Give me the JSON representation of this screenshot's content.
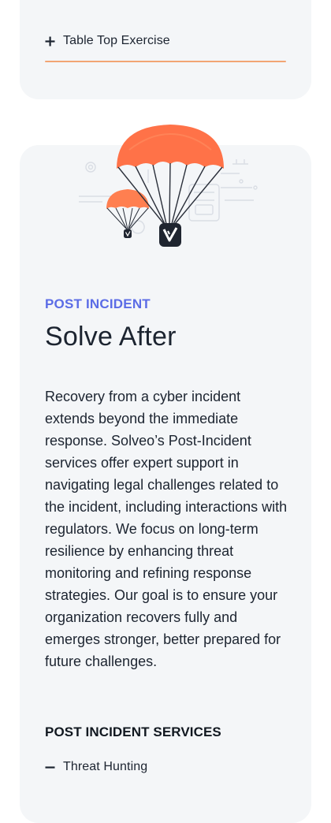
{
  "top_accordion": {
    "label": "Table Top Exercise",
    "icon": "plus-icon"
  },
  "illustration": {
    "icon": "parachute-illustration",
    "accent_color": "#ff7f50"
  },
  "section": {
    "eyebrow": "POST INCIDENT",
    "title": "Solve After",
    "body": "Recovery from a cyber incident extends beyond the immediate response. Solveo’s Post-Incident services offer expert support in navigating legal challenges related to the incident, including interactions with regulators. We focus on long-term resilience by enhancing threat monitoring and refining response strategies. Our goal is to ensure your organization recovers fully and emerges stronger, better prepared for future challenges."
  },
  "services": {
    "heading": "POST INCIDENT SERVICES",
    "items": [
      {
        "label": "Threat Hunting",
        "icon": "minus-icon"
      }
    ]
  },
  "colors": {
    "eyebrow": "#5b6ce6",
    "divider": "#f2a574",
    "card_bg": "#f4f6f8",
    "text": "#1c2430"
  }
}
